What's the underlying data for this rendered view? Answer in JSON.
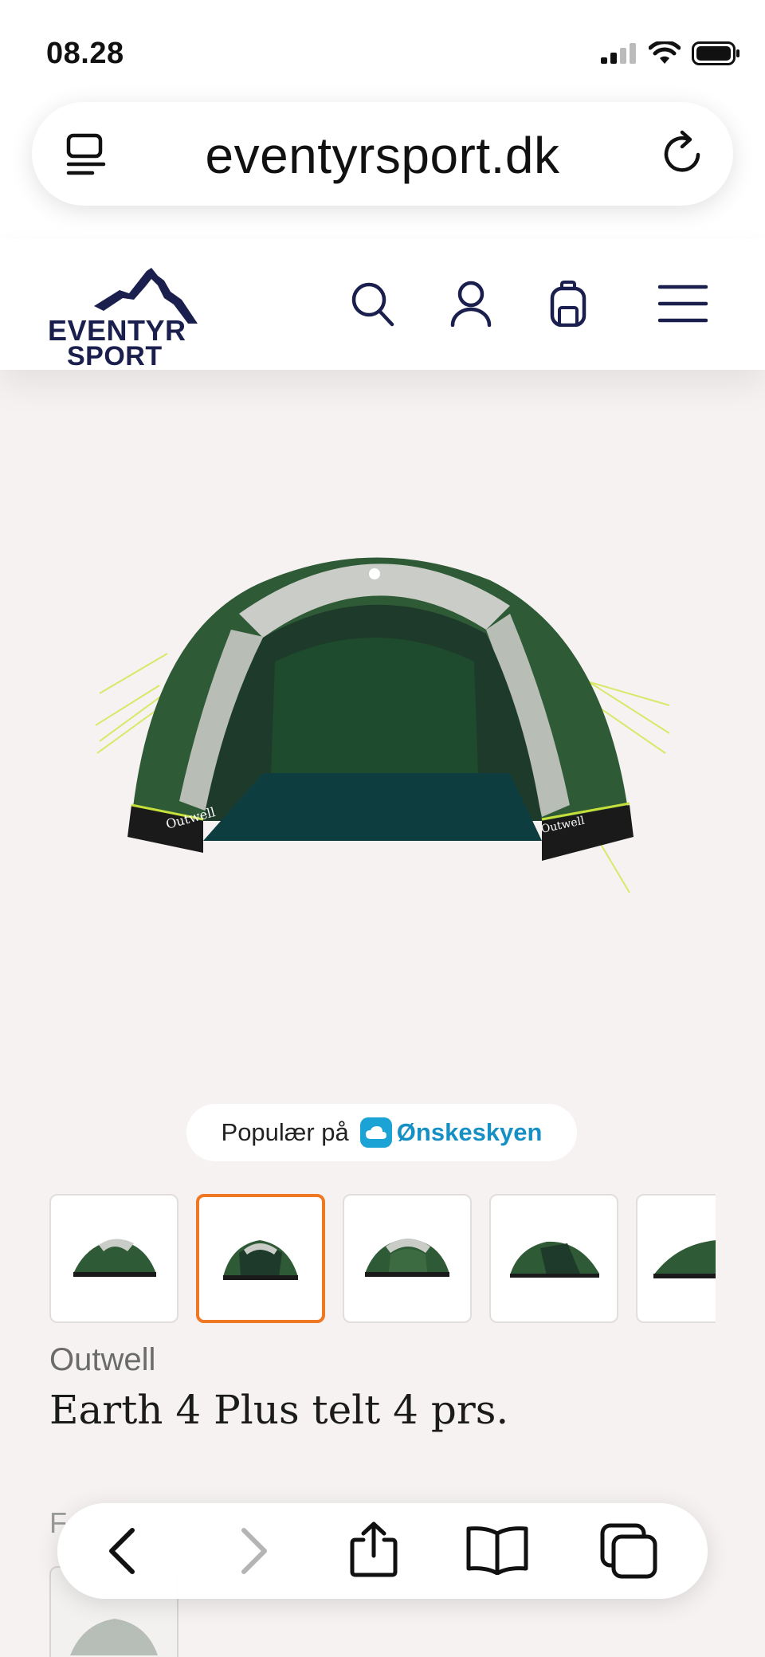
{
  "status_bar": {
    "time": "08.28"
  },
  "browser": {
    "url": "eventyrsport.dk"
  },
  "site": {
    "logo_line1": "EVENTYR",
    "logo_line2": "SPORT"
  },
  "popular": {
    "label": "Populær på",
    "service": "Ønskeskyen"
  },
  "product": {
    "brand": "Outwell",
    "title": "Earth 4 Plus telt 4 prs.",
    "thumbnails": 5,
    "active_thumbnail": 2
  },
  "colors": {
    "brand_navy": "#1b1f4d",
    "accent_orange": "#f07822",
    "onske_blue": "#1ba3d6",
    "tent_green": "#2f5a36"
  }
}
